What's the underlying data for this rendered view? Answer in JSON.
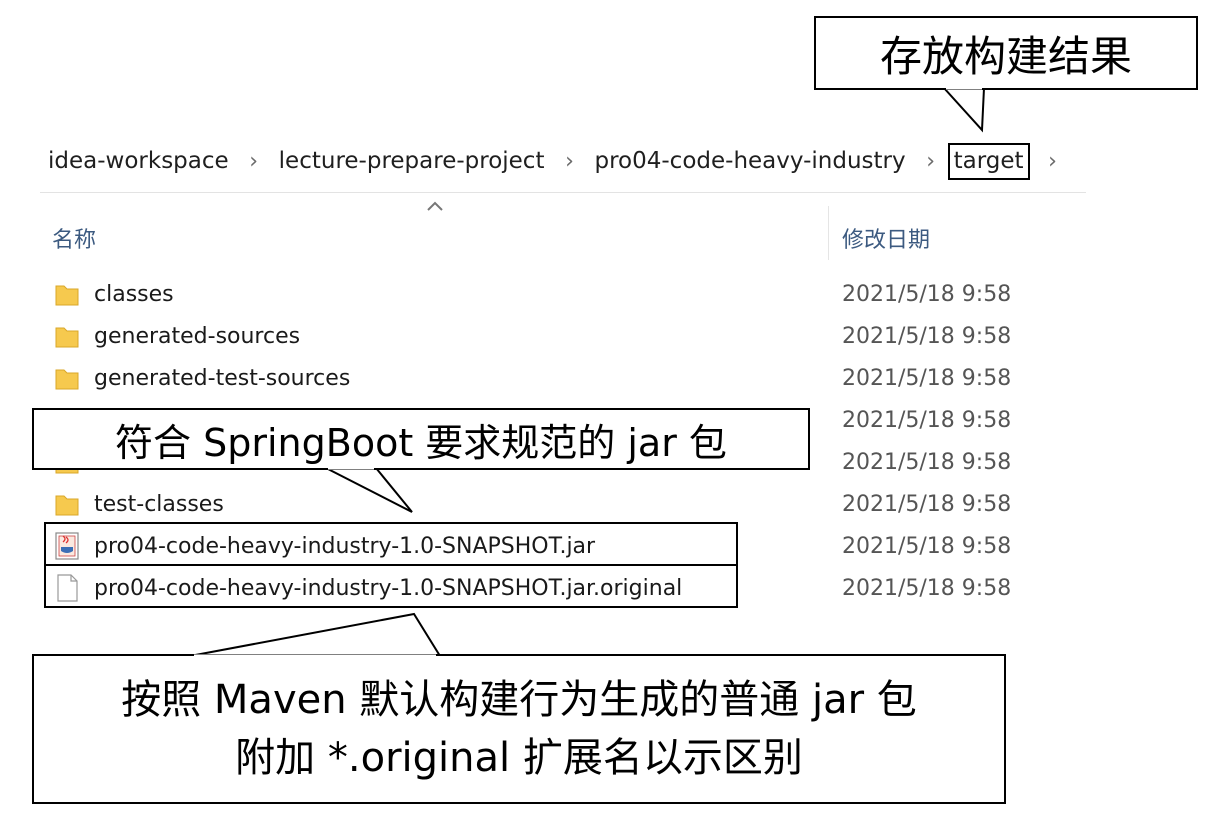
{
  "breadcrumb": {
    "items": [
      "idea-workspace",
      "lecture-prepare-project",
      "pro04-code-heavy-industry",
      "target"
    ],
    "separator": "›",
    "trailing_icon": "chevron-right-icon"
  },
  "columns": {
    "name": "名称",
    "date": "修改日期",
    "sort_icon": "sort-up-icon"
  },
  "files": [
    {
      "name": "classes",
      "date": "2021/5/18 9:58",
      "icon": "folder-icon"
    },
    {
      "name": "generated-sources",
      "date": "2021/5/18 9:58",
      "icon": "folder-icon"
    },
    {
      "name": "generated-test-sources",
      "date": "2021/5/18 9:58",
      "icon": "folder-icon"
    },
    {
      "name": "",
      "date": "2021/5/18 9:58",
      "icon": "folder-icon"
    },
    {
      "name": "",
      "date": "2021/5/18 9:58",
      "icon": "folder-icon"
    },
    {
      "name": "test-classes",
      "date": "2021/5/18 9:58",
      "icon": "folder-icon"
    },
    {
      "name": "pro04-code-heavy-industry-1.0-SNAPSHOT.jar",
      "date": "2021/5/18 9:58",
      "icon": "java-jar-icon"
    },
    {
      "name": "pro04-code-heavy-industry-1.0-SNAPSHOT.jar.original",
      "date": "2021/5/18 9:58",
      "icon": "file-icon"
    }
  ],
  "callouts": {
    "top": "存放构建结果",
    "middle": "符合 SpringBoot 要求规范的 jar 包",
    "bottom_line1": "按照 Maven 默认构建行为生成的普通 jar 包",
    "bottom_line2": "附加 *.original 扩展名以示区别"
  },
  "colors": {
    "folder": "#f6c94e",
    "header_text": "#3c5a80",
    "date_text": "#555555"
  }
}
